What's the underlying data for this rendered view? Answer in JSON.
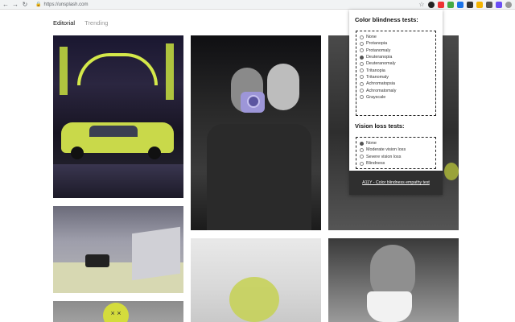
{
  "browser": {
    "url": "https://unsplash.com",
    "back": "←",
    "forward": "→",
    "reload": "↻",
    "lock": "🔒",
    "star": "☆"
  },
  "page": {
    "tabs": [
      {
        "label": "Editorial",
        "active": true
      },
      {
        "label": "Trending",
        "active": false
      }
    ]
  },
  "popup": {
    "color_heading": "Color blindness tests:",
    "color_options": [
      "None",
      "Protanopia",
      "Protanomaly",
      "Deuteranopia",
      "Deuteranomaly",
      "Tritanopia",
      "Tritanomaly",
      "Achromatopsia",
      "Achromatomaly",
      "Grayscale"
    ],
    "color_selected": "Deuteranopia",
    "vision_heading": "Vision loss tests:",
    "vision_options": [
      "None",
      "Moderate vision loss",
      "Severe vision loss",
      "Blindness"
    ],
    "vision_selected": "None",
    "footer_link": "A11Y - Color blindness empathy test"
  },
  "colors": {
    "accent_yellow": "#c9d94a",
    "accent_purple": "#9d96d8",
    "footer_bg": "#2f2f2f"
  },
  "photos": [
    {
      "subject": "neon street with taxi"
    },
    {
      "subject": "two women with instant camera"
    },
    {
      "subject": "person with dark clothing"
    },
    {
      "subject": "laptop and camera on table"
    },
    {
      "subject": "emoji balloon"
    },
    {
      "subject": "green drink"
    },
    {
      "subject": "woman drinking from cup"
    }
  ]
}
